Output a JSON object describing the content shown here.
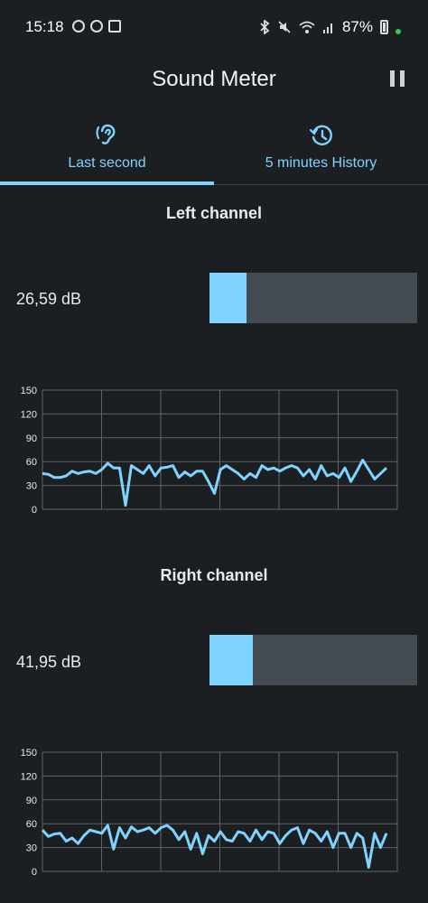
{
  "status_bar": {
    "time": "15:18",
    "battery": "87%"
  },
  "app": {
    "title": "Sound Meter",
    "pause_icon": "pause-icon"
  },
  "tabs": [
    {
      "label": "Last second",
      "icon": "ear-icon",
      "selected": true
    },
    {
      "label": "5 minutes History",
      "icon": "history-icon",
      "selected": false
    }
  ],
  "left_channel": {
    "title": "Left channel",
    "db_value": "26,59 dB",
    "meter_fraction": 0.18
  },
  "right_channel": {
    "title": "Right channel",
    "db_value": "41,95 dB",
    "meter_fraction": 0.21
  },
  "colors": {
    "accent": "#7fd3ff",
    "background": "#1c1f22",
    "meter_track": "#444a51"
  },
  "chart_data": [
    {
      "type": "line",
      "title": "Left channel",
      "ylim": [
        0,
        150
      ],
      "yticks": [
        0,
        30,
        60,
        90,
        120,
        150
      ],
      "grid": true,
      "values": [
        45,
        44,
        40,
        40,
        42,
        48,
        45,
        47,
        48,
        45,
        50,
        58,
        52,
        52,
        5,
        55,
        50,
        45,
        55,
        42,
        52,
        53,
        55,
        40,
        47,
        42,
        48,
        48,
        35,
        20,
        50,
        55,
        50,
        45,
        38,
        45,
        40,
        55,
        50,
        52,
        48,
        52,
        55,
        52,
        42,
        50,
        38,
        55,
        42,
        45,
        40,
        52,
        35,
        48,
        62,
        50,
        38,
        45,
        52
      ],
      "series_name": ""
    },
    {
      "type": "line",
      "title": "Right channel",
      "ylim": [
        0,
        150
      ],
      "yticks": [
        0,
        30,
        60,
        90,
        120,
        150
      ],
      "grid": true,
      "values": [
        52,
        44,
        47,
        48,
        38,
        42,
        35,
        45,
        52,
        50,
        48,
        58,
        28,
        55,
        42,
        56,
        50,
        52,
        55,
        48,
        55,
        58,
        52,
        40,
        50,
        28,
        48,
        22,
        45,
        38,
        50,
        40,
        38,
        50,
        48,
        38,
        52,
        40,
        50,
        48,
        35,
        45,
        52,
        55,
        35,
        52,
        48,
        38,
        50,
        30,
        48,
        48,
        30,
        48,
        42,
        5,
        48,
        30,
        48
      ],
      "series_name": ""
    }
  ]
}
